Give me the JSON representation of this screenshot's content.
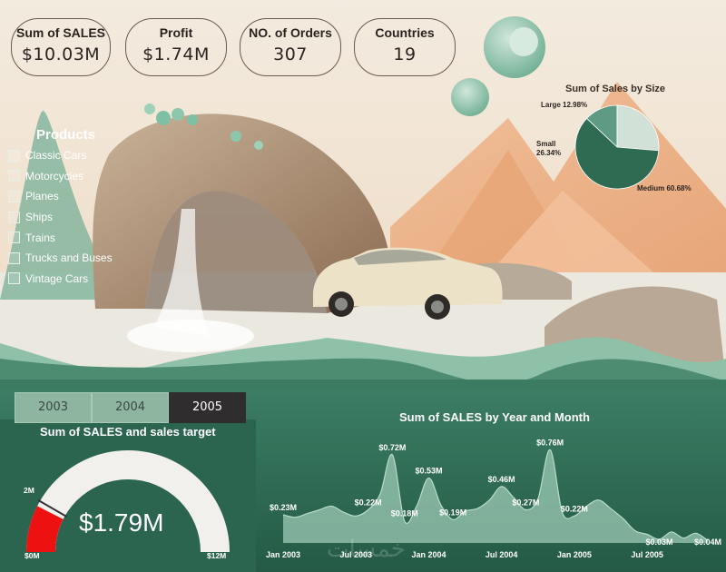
{
  "kpis": [
    {
      "label": "Sum of SALES",
      "value": "$10.03M"
    },
    {
      "label": "Profit",
      "value": "$1.74M"
    },
    {
      "label": "NO. of Orders",
      "value": "307"
    },
    {
      "label": "Countries",
      "value": "19"
    }
  ],
  "products": {
    "title": "Products",
    "items": [
      "Classic Cars",
      "Motorcycles",
      "Planes",
      "Ships",
      "Trains",
      "Trucks and Buses",
      "Vintage Cars"
    ]
  },
  "year_tabs": {
    "items": [
      "2003",
      "2004",
      "2005"
    ],
    "selected": "2005"
  },
  "watermark": "خمسات",
  "colors": {
    "dark_green": "#2e6a53",
    "mid_green": "#5e9a84",
    "light_green": "#c8dccf",
    "red": "#ee1111",
    "peach": "#eab48a"
  },
  "chart_data": [
    {
      "type": "pie",
      "title": "Sum of Sales by Size",
      "slices": [
        {
          "name": "Large",
          "value": 12.98,
          "label": "Large 12.98%",
          "color": "#5e9a84"
        },
        {
          "name": "Small",
          "value": 26.34,
          "label": "Small 26.34%",
          "color": "#d2e1d8"
        },
        {
          "name": "Medium",
          "value": 60.68,
          "label": "Medium 60.68%",
          "color": "#2f6a52"
        }
      ],
      "legend": "none"
    },
    {
      "type": "gauge",
      "title": "Sum of SALES and sales target",
      "value": 1.79,
      "value_label": "$1.79M",
      "target": 2,
      "target_label": "2M",
      "min": 0,
      "max": 12,
      "min_label": "$0M",
      "max_label": "$12M"
    },
    {
      "type": "area",
      "title": "Sum of SALES by Year and Month",
      "x": [
        "2003-01",
        "2003-02",
        "2003-03",
        "2003-04",
        "2003-05",
        "2003-06",
        "2003-07",
        "2003-08",
        "2003-09",
        "2003-10",
        "2003-11",
        "2003-12",
        "2004-01",
        "2004-02",
        "2004-03",
        "2004-04",
        "2004-05",
        "2004-06",
        "2004-07",
        "2004-08",
        "2004-09",
        "2004-10",
        "2004-11",
        "2004-12",
        "2005-01",
        "2005-02",
        "2005-03",
        "2005-04",
        "2005-05",
        "2005-06",
        "2005-07",
        "2005-08",
        "2005-09",
        "2005-10",
        "2005-11",
        "2005-12"
      ],
      "y": [
        0.23,
        0.21,
        0.24,
        0.27,
        0.3,
        0.25,
        0.22,
        0.27,
        0.4,
        0.72,
        0.18,
        0.3,
        0.53,
        0.31,
        0.19,
        0.26,
        0.28,
        0.35,
        0.46,
        0.37,
        0.27,
        0.36,
        0.76,
        0.25,
        0.22,
        0.3,
        0.35,
        0.28,
        0.2,
        0.1,
        0.07,
        0.03,
        0.09,
        0.04,
        0.08,
        0.02
      ],
      "xtick_labels": [
        {
          "x": "2003-01",
          "label": "Jan 2003"
        },
        {
          "x": "2003-07",
          "label": "Jul 2003"
        },
        {
          "x": "2004-01",
          "label": "Jan 2004"
        },
        {
          "x": "2004-07",
          "label": "Jul 2004"
        },
        {
          "x": "2005-01",
          "label": "Jan 2005"
        },
        {
          "x": "2005-07",
          "label": "Jul 2005"
        }
      ],
      "data_labels": [
        {
          "x": "2003-01",
          "label": "$0.23M"
        },
        {
          "x": "2003-08",
          "label": "$0.22M"
        },
        {
          "x": "2003-10",
          "label": "$0.72M"
        },
        {
          "x": "2003-11",
          "label": "$0.18M"
        },
        {
          "x": "2004-01",
          "label": "$0.53M"
        },
        {
          "x": "2004-03",
          "label": "$0.19M"
        },
        {
          "x": "2004-07",
          "label": "$0.46M"
        },
        {
          "x": "2004-09",
          "label": "$0.27M"
        },
        {
          "x": "2004-11",
          "label": "$0.76M"
        },
        {
          "x": "2005-01",
          "label": "$0.22M"
        },
        {
          "x": "2005-08",
          "label": "$0.03M"
        },
        {
          "x": "2005-12",
          "label": "$0.04M"
        }
      ],
      "ylim": [
        0,
        0.8
      ],
      "grid": false
    }
  ]
}
